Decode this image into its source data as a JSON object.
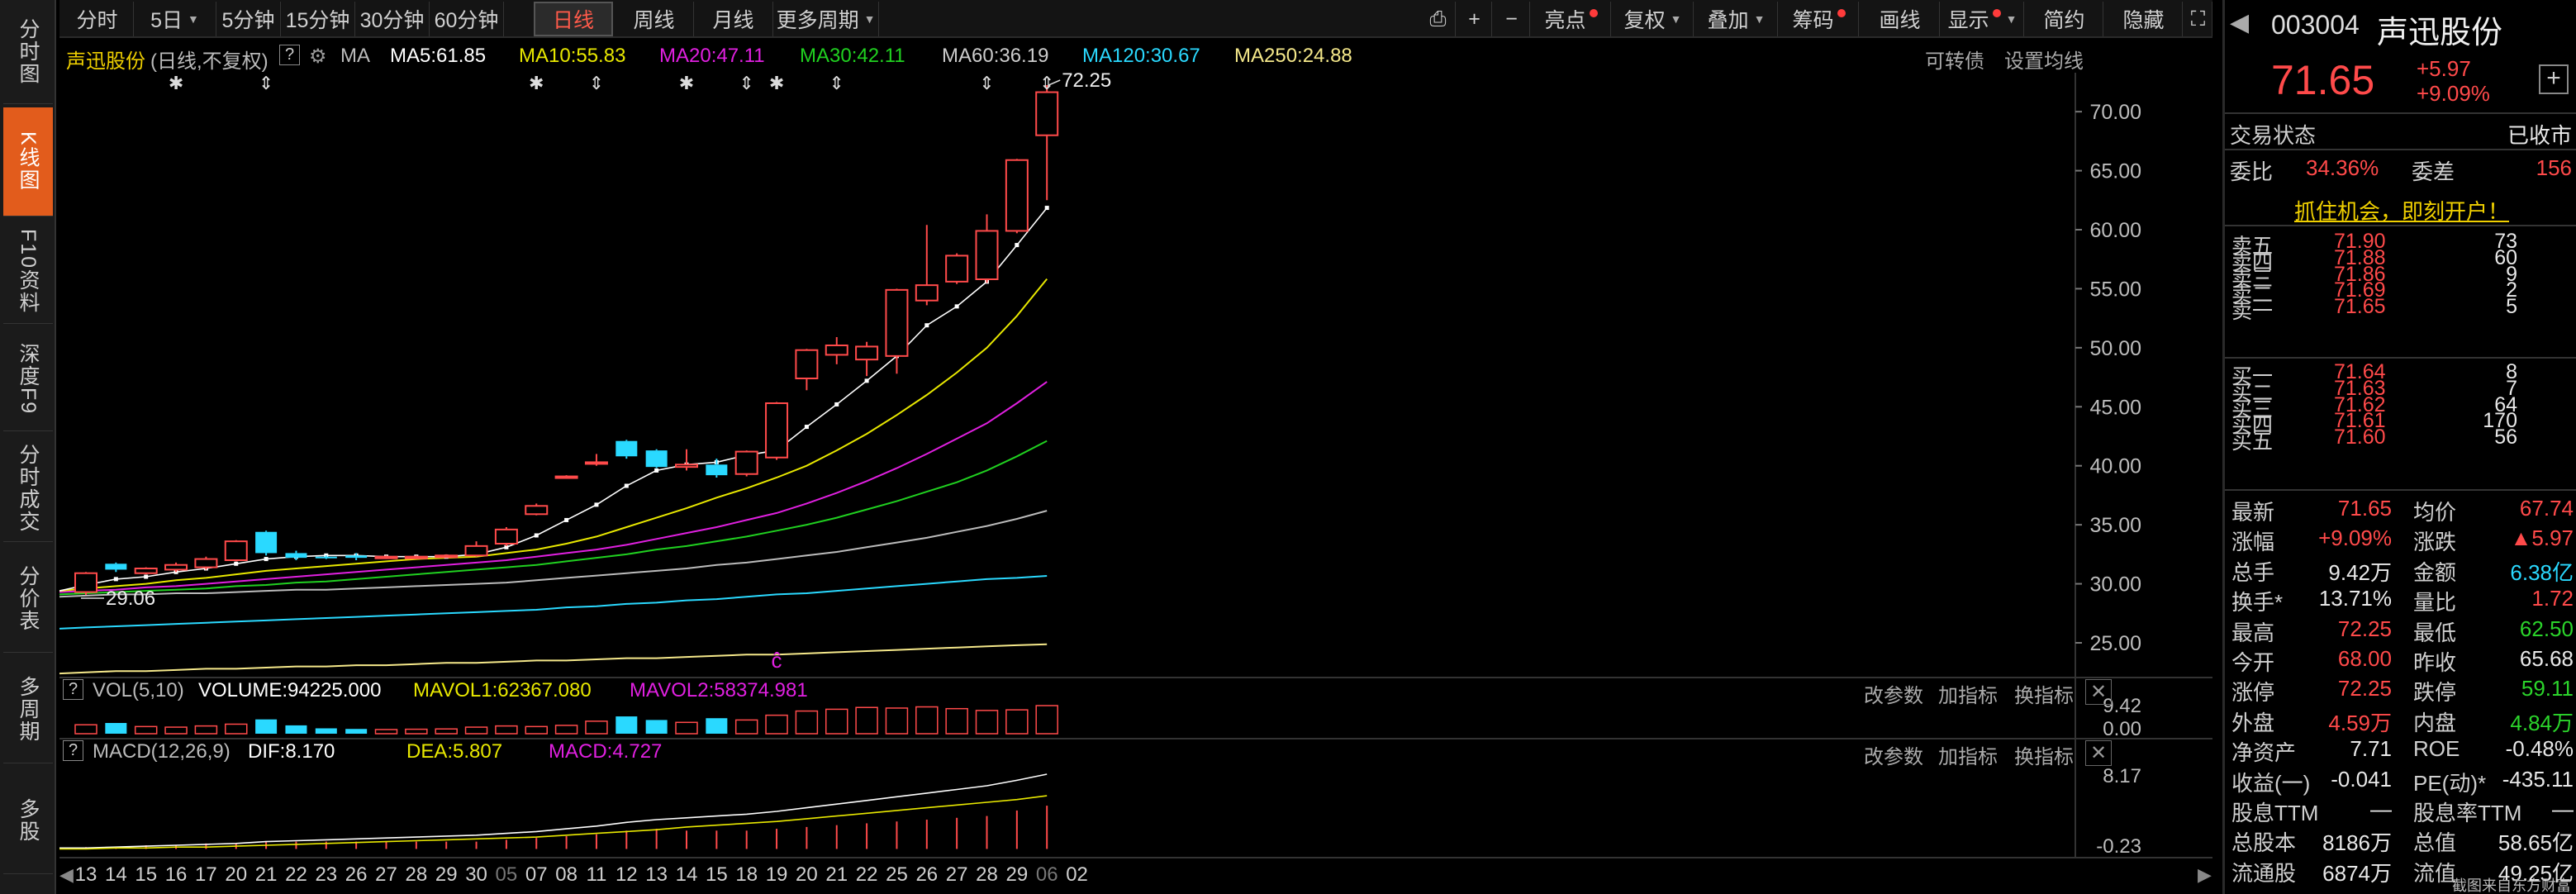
{
  "sidebar": {
    "tabs": [
      {
        "label": "分时图",
        "active": false
      },
      {
        "label": "K线图",
        "active": true
      },
      {
        "label": "F10资料",
        "active": false
      },
      {
        "label": "深度F9",
        "active": false
      },
      {
        "label": "分时成交",
        "active": false
      },
      {
        "label": "分价表",
        "active": false
      },
      {
        "label": "多周期",
        "active": false
      },
      {
        "label": "多股",
        "active": false
      }
    ]
  },
  "toolbar": {
    "periods": [
      "分时",
      "5日",
      "5分钟",
      "15分钟",
      "30分钟",
      "60分钟",
      "日线",
      "周线",
      "月线",
      "更多周期"
    ],
    "active_period": "日线",
    "tools": [
      "亮点",
      "复权",
      "叠加",
      "筹码",
      "画线",
      "显示",
      "简约",
      "隐藏"
    ]
  },
  "ma_line": {
    "stock_name": "声迅股份",
    "mode": "(日线,不复权)",
    "ma_label": "MA",
    "ma5": "MA5:61.85",
    "ma10": "MA10:55.83",
    "ma20": "MA20:47.11",
    "ma30": "MA30:42.11",
    "ma60": "MA60:36.19",
    "ma120": "MA120:30.67",
    "ma250": "MA250:24.88",
    "convertible": "可转债",
    "set_ma": "设置均线"
  },
  "volume_pane": {
    "indicator": "VOL(5,10)",
    "volume": "VOLUME:94225.000",
    "mavol1": "MAVOL1:62367.080",
    "mavol2": "MAVOL2:58374.981",
    "change_params": "改参数",
    "add_indicator": "加指标",
    "switch_indicator": "换指标",
    "axis_top": "9.42",
    "axis_bottom": "0.00"
  },
  "macd_pane": {
    "indicator": "MACD(12,26,9)",
    "dif": "DIF:8.170",
    "dea": "DEA:5.807",
    "macd": "MACD:4.727",
    "change_params": "改参数",
    "add_indicator": "加指标",
    "switch_indicator": "换指标",
    "axis_top": "8.17",
    "axis_bottom": "-0.23"
  },
  "colors": {
    "up": "#ff4a4a",
    "down": "#2ad9ff",
    "ma5": "#ffffff",
    "ma10": "#e8e800",
    "ma20": "#e020e0",
    "ma30": "#20d020",
    "ma60": "#bbbbbb",
    "ma120": "#2ad9ff",
    "ma250": "#f5e88a"
  },
  "chart_data": {
    "type": "candlestick",
    "price_axis": {
      "ticks": [
        "70.00",
        "65.00",
        "60.00",
        "55.00",
        "50.00",
        "45.00",
        "40.00",
        "35.00",
        "30.00",
        "25.00"
      ],
      "ylim": [
        22.2,
        73.3
      ]
    },
    "high_label": "72.25",
    "low_label": "29.06",
    "x_dates": [
      "13",
      "14",
      "15",
      "16",
      "17",
      "20",
      "21",
      "22",
      "23",
      "26",
      "27",
      "28",
      "29",
      "30",
      "05",
      "07",
      "08",
      "11",
      "12",
      "13",
      "14",
      "15",
      "18",
      "19",
      "20",
      "21",
      "22",
      "25",
      "26",
      "27",
      "28",
      "29",
      "06",
      "02"
    ],
    "candles": [
      {
        "o": 29.3,
        "c": 30.9,
        "h": 31.0,
        "l": 29.06
      },
      {
        "o": 31.7,
        "c": 31.2,
        "h": 31.8,
        "l": 31.0
      },
      {
        "o": 30.9,
        "c": 31.3,
        "h": 31.4,
        "l": 30.8
      },
      {
        "o": 31.2,
        "c": 31.6,
        "h": 31.8,
        "l": 31.0
      },
      {
        "o": 31.4,
        "c": 32.1,
        "h": 32.3,
        "l": 31.2
      },
      {
        "o": 32.0,
        "c": 33.6,
        "h": 33.7,
        "l": 31.9
      },
      {
        "o": 34.4,
        "c": 32.6,
        "h": 34.5,
        "l": 32.4
      },
      {
        "o": 32.6,
        "c": 32.2,
        "h": 32.8,
        "l": 32.0
      },
      {
        "o": 32.3,
        "c": 32.2,
        "h": 32.4,
        "l": 32.1
      },
      {
        "o": 32.4,
        "c": 32.2,
        "h": 32.6,
        "l": 32.0
      },
      {
        "o": 32.2,
        "c": 32.3,
        "h": 32.4,
        "l": 32.1
      },
      {
        "o": 32.2,
        "c": 32.3,
        "h": 32.4,
        "l": 32.1
      },
      {
        "o": 32.3,
        "c": 32.4,
        "h": 32.5,
        "l": 32.2
      },
      {
        "o": 32.4,
        "c": 33.2,
        "h": 33.6,
        "l": 32.3
      },
      {
        "o": 33.4,
        "c": 34.6,
        "h": 34.8,
        "l": 33.2
      },
      {
        "o": 35.9,
        "c": 36.6,
        "h": 36.8,
        "l": 35.8
      },
      {
        "o": 39.0,
        "c": 39.1,
        "h": 39.2,
        "l": 38.9
      },
      {
        "o": 40.2,
        "c": 40.3,
        "h": 41.0,
        "l": 40.0
      },
      {
        "o": 42.1,
        "c": 40.8,
        "h": 42.2,
        "l": 40.6
      },
      {
        "o": 41.3,
        "c": 39.9,
        "h": 41.4,
        "l": 39.8
      },
      {
        "o": 39.9,
        "c": 40.1,
        "h": 41.4,
        "l": 39.6
      },
      {
        "o": 40.1,
        "c": 39.2,
        "h": 40.6,
        "l": 39.0
      },
      {
        "o": 39.3,
        "c": 41.2,
        "h": 41.3,
        "l": 39.1
      },
      {
        "o": 40.7,
        "c": 45.3,
        "h": 45.4,
        "l": 40.5
      },
      {
        "o": 47.4,
        "c": 49.8,
        "h": 49.9,
        "l": 46.4
      },
      {
        "o": 49.4,
        "c": 50.2,
        "h": 50.9,
        "l": 48.6
      },
      {
        "o": 49.0,
        "c": 50.1,
        "h": 50.5,
        "l": 47.6
      },
      {
        "o": 49.3,
        "c": 54.9,
        "h": 55.0,
        "l": 47.8
      },
      {
        "o": 54.0,
        "c": 55.3,
        "h": 60.4,
        "l": 53.6
      },
      {
        "o": 55.6,
        "c": 57.8,
        "h": 58.0,
        "l": 55.4
      },
      {
        "o": 55.8,
        "c": 59.9,
        "h": 61.3,
        "l": 55.5
      },
      {
        "o": 59.9,
        "c": 65.9,
        "h": 66.0,
        "l": 59.7
      },
      {
        "o": 68.0,
        "c": 71.65,
        "h": 72.25,
        "l": 62.5
      }
    ],
    "ma5": [
      29.9,
      30.4,
      30.6,
      31.0,
      31.3,
      31.7,
      32.1,
      32.3,
      32.4,
      32.4,
      32.3,
      32.3,
      32.3,
      32.5,
      33.1,
      34.1,
      35.4,
      36.7,
      38.3,
      39.6,
      40.1,
      40.3,
      40.9,
      41.3,
      43.3,
      45.2,
      47.2,
      49.3,
      51.9,
      53.5,
      55.6,
      58.7,
      61.85
    ],
    "ma10": [
      29.6,
      29.8,
      30.0,
      30.3,
      30.5,
      30.8,
      31.1,
      31.3,
      31.5,
      31.7,
      31.9,
      32.1,
      32.2,
      32.3,
      32.6,
      32.9,
      33.4,
      34.0,
      34.8,
      35.6,
      36.4,
      37.3,
      38.1,
      39.0,
      40.0,
      41.3,
      42.7,
      44.3,
      46.0,
      47.9,
      50.0,
      52.7,
      55.83
    ],
    "ma20": [
      29.4,
      29.5,
      29.7,
      29.8,
      30.0,
      30.2,
      30.4,
      30.6,
      30.8,
      31.0,
      31.2,
      31.4,
      31.6,
      31.8,
      32.0,
      32.3,
      32.6,
      32.9,
      33.3,
      33.8,
      34.3,
      34.8,
      35.4,
      36.0,
      36.8,
      37.7,
      38.7,
      39.8,
      41.0,
      42.3,
      43.6,
      45.3,
      47.11
    ],
    "ma30": [
      29.2,
      29.3,
      29.4,
      29.5,
      29.6,
      29.8,
      29.9,
      30.1,
      30.2,
      30.4,
      30.6,
      30.8,
      31.0,
      31.2,
      31.4,
      31.6,
      31.9,
      32.2,
      32.5,
      32.9,
      33.2,
      33.6,
      34.0,
      34.5,
      35.0,
      35.6,
      36.3,
      37.0,
      37.8,
      38.6,
      39.6,
      40.8,
      42.11
    ],
    "ma60": [
      29.0,
      29.1,
      29.1,
      29.2,
      29.2,
      29.3,
      29.4,
      29.5,
      29.5,
      29.6,
      29.7,
      29.8,
      29.9,
      30.0,
      30.1,
      30.3,
      30.5,
      30.7,
      30.9,
      31.1,
      31.3,
      31.6,
      31.8,
      32.1,
      32.4,
      32.7,
      33.1,
      33.5,
      33.9,
      34.4,
      34.9,
      35.5,
      36.19
    ],
    "ma120": [
      26.3,
      26.4,
      26.5,
      26.6,
      26.7,
      26.8,
      26.9,
      27.0,
      27.1,
      27.2,
      27.3,
      27.4,
      27.5,
      27.6,
      27.7,
      27.8,
      28.0,
      28.1,
      28.3,
      28.4,
      28.6,
      28.7,
      28.9,
      29.1,
      29.2,
      29.4,
      29.6,
      29.8,
      30.0,
      30.2,
      30.4,
      30.5,
      30.67
    ],
    "ma250": [
      22.5,
      22.6,
      22.6,
      22.7,
      22.8,
      22.8,
      22.9,
      23.0,
      23.0,
      23.1,
      23.1,
      23.2,
      23.3,
      23.3,
      23.4,
      23.5,
      23.5,
      23.6,
      23.7,
      23.7,
      23.8,
      23.9,
      24.0,
      24.0,
      24.1,
      24.2,
      24.3,
      24.4,
      24.5,
      24.6,
      24.7,
      24.8,
      24.88
    ],
    "volume": [
      3.0,
      3.6,
      2.4,
      2.2,
      2.6,
      3.2,
      4.8,
      2.8,
      1.8,
      1.6,
      1.4,
      1.5,
      1.6,
      2.2,
      2.6,
      2.4,
      2.8,
      4.2,
      5.8,
      4.6,
      3.8,
      5.2,
      4.6,
      6.2,
      7.6,
      8.2,
      8.8,
      8.6,
      9.0,
      8.4,
      7.8,
      8.0,
      9.42
    ],
    "macd_dif": [
      0.1,
      0.2,
      0.3,
      0.4,
      0.5,
      0.6,
      0.8,
      0.9,
      1.0,
      1.1,
      1.2,
      1.3,
      1.4,
      1.5,
      1.7,
      1.9,
      2.2,
      2.5,
      2.9,
      3.2,
      3.4,
      3.6,
      3.8,
      4.1,
      4.5,
      4.9,
      5.3,
      5.7,
      6.1,
      6.5,
      6.9,
      7.5,
      8.17
    ],
    "macd_dea": [
      0.0,
      0.1,
      0.1,
      0.2,
      0.2,
      0.3,
      0.4,
      0.5,
      0.6,
      0.7,
      0.8,
      0.9,
      1.0,
      1.1,
      1.2,
      1.3,
      1.5,
      1.7,
      1.9,
      2.1,
      2.4,
      2.6,
      2.8,
      3.0,
      3.3,
      3.6,
      3.9,
      4.2,
      4.5,
      4.8,
      5.1,
      5.4,
      5.807
    ],
    "macd_hist": [
      0.2,
      0.2,
      0.4,
      0.4,
      0.6,
      0.6,
      0.8,
      0.8,
      0.8,
      0.8,
      0.8,
      0.8,
      0.8,
      0.8,
      1.0,
      1.2,
      1.4,
      1.6,
      2.0,
      2.2,
      2.0,
      2.0,
      2.0,
      2.2,
      2.4,
      2.6,
      2.8,
      3.0,
      3.2,
      3.4,
      3.6,
      4.2,
      4.727
    ]
  },
  "right_panel": {
    "code": "003004",
    "name": "声迅股份",
    "price": "71.65",
    "change": "+5.97",
    "change_pct": "+9.09%",
    "trade_status_label": "交易状态",
    "trade_status": "已收市",
    "weibi_label": "委比",
    "weibi": "34.36%",
    "weicha_label": "委差",
    "weicha": "156",
    "promo": "抓住机会，即刻开户！",
    "asks": [
      {
        "label": "卖五",
        "price": "71.90",
        "vol": "73"
      },
      {
        "label": "卖四",
        "price": "71.88",
        "vol": "60"
      },
      {
        "label": "卖三",
        "price": "71.86",
        "vol": "9"
      },
      {
        "label": "卖二",
        "price": "71.69",
        "vol": "2"
      },
      {
        "label": "卖一",
        "price": "71.65",
        "vol": "5"
      }
    ],
    "bids": [
      {
        "label": "买一",
        "price": "71.64",
        "vol": "8"
      },
      {
        "label": "买二",
        "price": "71.63",
        "vol": "7"
      },
      {
        "label": "买三",
        "price": "71.62",
        "vol": "64"
      },
      {
        "label": "买四",
        "price": "71.61",
        "vol": "170"
      },
      {
        "label": "买五",
        "price": "71.60",
        "vol": "56"
      }
    ],
    "stats": [
      {
        "l1": "最新",
        "v1": "71.65",
        "c1": "red",
        "l2": "均价",
        "v2": "67.74",
        "c2": "red"
      },
      {
        "l1": "涨幅",
        "v1": "+9.09%",
        "c1": "red",
        "l2": "涨跌",
        "v2": "▲5.97",
        "c2": "red"
      },
      {
        "l1": "总手",
        "v1": "9.42万",
        "c1": "white",
        "l2": "金额",
        "v2": "6.38亿",
        "c2": "cyan"
      },
      {
        "l1": "换手*",
        "v1": "13.71%",
        "c1": "white",
        "l2": "量比",
        "v2": "1.72",
        "c2": "red"
      },
      {
        "l1": "最高",
        "v1": "72.25",
        "c1": "red",
        "l2": "最低",
        "v2": "62.50",
        "c2": "green"
      },
      {
        "l1": "今开",
        "v1": "68.00",
        "c1": "red",
        "l2": "昨收",
        "v2": "65.68",
        "c2": "white"
      },
      {
        "l1": "涨停",
        "v1": "72.25",
        "c1": "red",
        "l2": "跌停",
        "v2": "59.11",
        "c2": "green"
      },
      {
        "l1": "外盘",
        "v1": "4.59万",
        "c1": "red",
        "l2": "内盘",
        "v2": "4.84万",
        "c2": "green"
      },
      {
        "l1": "净资产",
        "v1": "7.71",
        "c1": "white",
        "l2": "ROE",
        "v2": "-0.48%",
        "c2": "white"
      },
      {
        "l1": "收益(一)",
        "v1": "-0.041",
        "c1": "white",
        "l2": "PE(动)*",
        "v2": "-435.11",
        "c2": "white"
      },
      {
        "l1": "股息TTM",
        "v1": "—",
        "c1": "white",
        "l2": "股息率TTM",
        "v2": "—",
        "c2": "white"
      },
      {
        "l1": "总股本",
        "v1": "8186万",
        "c1": "white",
        "l2": "总值",
        "v2": "58.65亿",
        "c2": "white"
      },
      {
        "l1": "流通股",
        "v1": "6874万",
        "c1": "white",
        "l2": "流值",
        "v2": "49.25亿",
        "c2": "white"
      }
    ],
    "footer": "截图来自东方财富"
  }
}
